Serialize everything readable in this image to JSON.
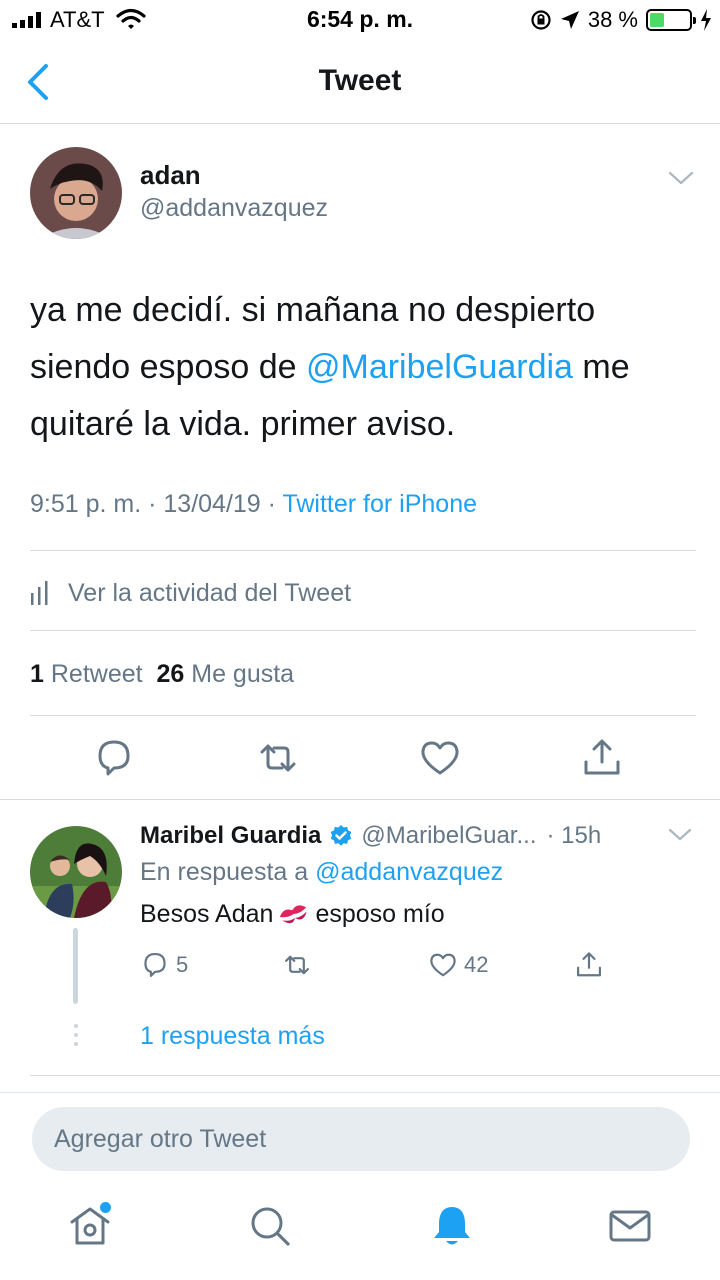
{
  "status_bar": {
    "carrier": "AT&T",
    "time": "6:54 p. m.",
    "battery_percent": "38 %",
    "battery_level": 0.38
  },
  "nav": {
    "title": "Tweet",
    "back_icon": "chevron-left-icon"
  },
  "tweet": {
    "author_name": "adan",
    "author_handle": "@addanvazquez",
    "text_before": "ya me decidí. si mañana no despierto siendo esposo de ",
    "mention": "@MaribelGuardia",
    "text_after": " me quitaré la vida. primer aviso.",
    "time": "9:51 p. m.",
    "date": "13/04/19",
    "source": "Twitter for iPhone",
    "activity_label": "Ver la actividad del Tweet",
    "retweet_count": "1",
    "retweet_label": "Retweet",
    "like_count": "26",
    "like_label": "Me gusta"
  },
  "reply": {
    "author_name": "Maribel Guardia",
    "author_handle": "@MaribelGuar...",
    "time": "15h",
    "in_reply_prefix": "En respuesta a",
    "in_reply_handle": "@addanvazquez",
    "text_before": "Besos Adan",
    "text_after": "esposo mío",
    "reply_count": "5",
    "like_count": "42",
    "more_replies": "1 respuesta más"
  },
  "composer": {
    "placeholder": "Agregar otro Tweet"
  },
  "tabbar": {
    "items": [
      "home-icon",
      "search-icon",
      "notifications-icon",
      "messages-icon"
    ]
  },
  "colors": {
    "accent": "#1da1f2",
    "text": "#14171a",
    "secondary": "#657786",
    "divider": "#d6dbe0"
  }
}
